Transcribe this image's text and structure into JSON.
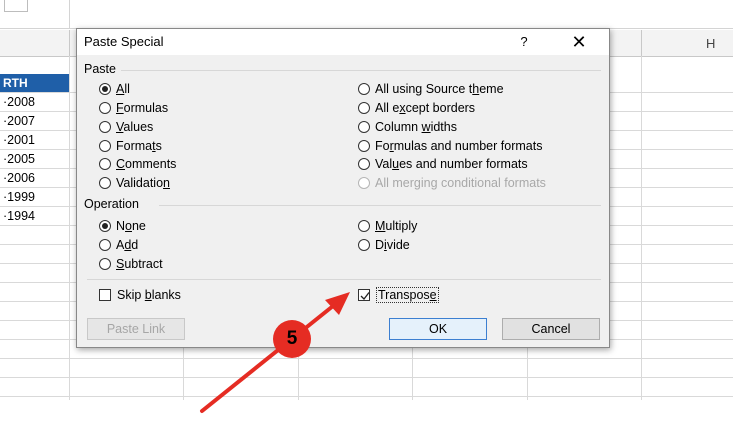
{
  "spreadsheet": {
    "column_header_h": "H",
    "header_cell": "RTH",
    "year_cells": [
      "·2008",
      "·2007",
      "·2001",
      "·2005",
      "·2006",
      "·1999",
      "·1994"
    ]
  },
  "dialog": {
    "title": "Paste Special",
    "help_label": "?",
    "close_label": "✕",
    "paste_group_label": "Paste",
    "paste_options_left": [
      {
        "pre": "",
        "u": "A",
        "post": "ll",
        "selected": true
      },
      {
        "pre": "",
        "u": "F",
        "post": "ormulas",
        "selected": false
      },
      {
        "pre": "",
        "u": "V",
        "post": "alues",
        "selected": false
      },
      {
        "pre": "Forma",
        "u": "t",
        "post": "s",
        "selected": false
      },
      {
        "pre": "",
        "u": "C",
        "post": "omments",
        "selected": false
      },
      {
        "pre": "Validatio",
        "u": "n",
        "post": "",
        "selected": false
      }
    ],
    "paste_options_right": [
      {
        "pre": "All using Source t",
        "u": "h",
        "post": "eme",
        "disabled": false
      },
      {
        "pre": "All e",
        "u": "x",
        "post": "cept borders",
        "disabled": false
      },
      {
        "pre": "Column ",
        "u": "w",
        "post": "idths",
        "disabled": false
      },
      {
        "pre": "Fo",
        "u": "r",
        "post": "mulas and number formats",
        "disabled": false
      },
      {
        "pre": "Val",
        "u": "u",
        "post": "es and number formats",
        "disabled": false
      },
      {
        "pre": "All merging conditional formats",
        "u": "",
        "post": "",
        "disabled": true
      }
    ],
    "operation_group_label": "Operation",
    "operation_options_left": [
      {
        "pre": "N",
        "u": "o",
        "post": "ne",
        "selected": true
      },
      {
        "pre": "A",
        "u": "d",
        "post": "d",
        "selected": false
      },
      {
        "pre": "",
        "u": "S",
        "post": "ubtract",
        "selected": false
      }
    ],
    "operation_options_right": [
      {
        "pre": "",
        "u": "M",
        "post": "ultiply",
        "selected": false
      },
      {
        "pre": "D",
        "u": "i",
        "post": "vide",
        "selected": false
      }
    ],
    "skip_blanks": {
      "pre": "Skip ",
      "u": "b",
      "post": "lanks",
      "checked": false
    },
    "transpose": {
      "pre": "Transpos",
      "u": "e",
      "post": "",
      "checked": true
    },
    "paste_link_label": "Paste Link",
    "ok_label": "OK",
    "cancel_label": "Cancel"
  },
  "annotation": {
    "step_number": "5",
    "color": "#e52c23"
  }
}
